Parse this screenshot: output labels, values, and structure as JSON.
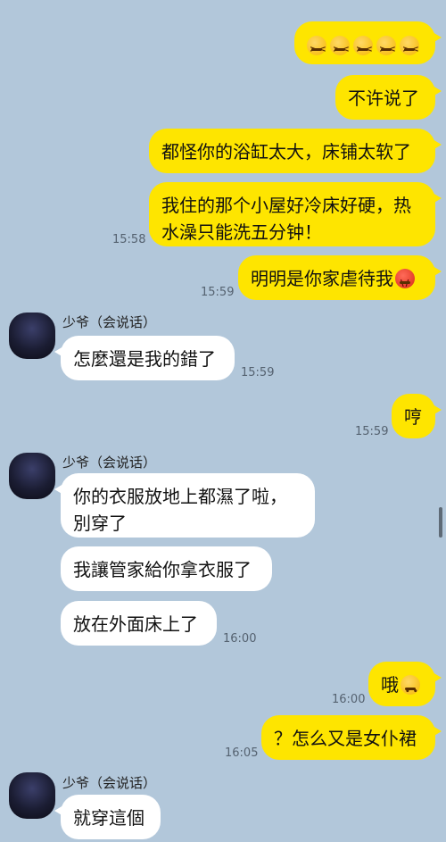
{
  "sender_name": "少爷（会说话）",
  "messages": {
    "m1_emojis": [
      "confounded-face-icon",
      "confounded-face-icon",
      "confounded-face-icon",
      "confounded-face-icon",
      "confounded-face-icon"
    ],
    "m2": "不许说了",
    "m3": "都怪你的浴缸太大，床铺太软了",
    "m4_line1": "我住的那个小屋好冷床好硬，热",
    "m4_line2": "水澡只能洗五分钟！",
    "m4_time": "15:58",
    "m5": "明明是你家虐待我",
    "m5_time": "15:59",
    "m6": "怎麼還是我的錯了",
    "m6_time": "15:59",
    "m7": "哼",
    "m7_time": "15:59",
    "m8_line1": "你的衣服放地上都濕了啦，",
    "m8_line2": "別穿了",
    "m9": "我讓管家給你拿衣服了",
    "m10": "放在外面床上了",
    "m10_time": "16:00",
    "m11": "哦",
    "m11_time": "16:00",
    "m12": "？怎么又是女仆裙",
    "m12_time": "16:05",
    "m13": "就穿這個"
  }
}
